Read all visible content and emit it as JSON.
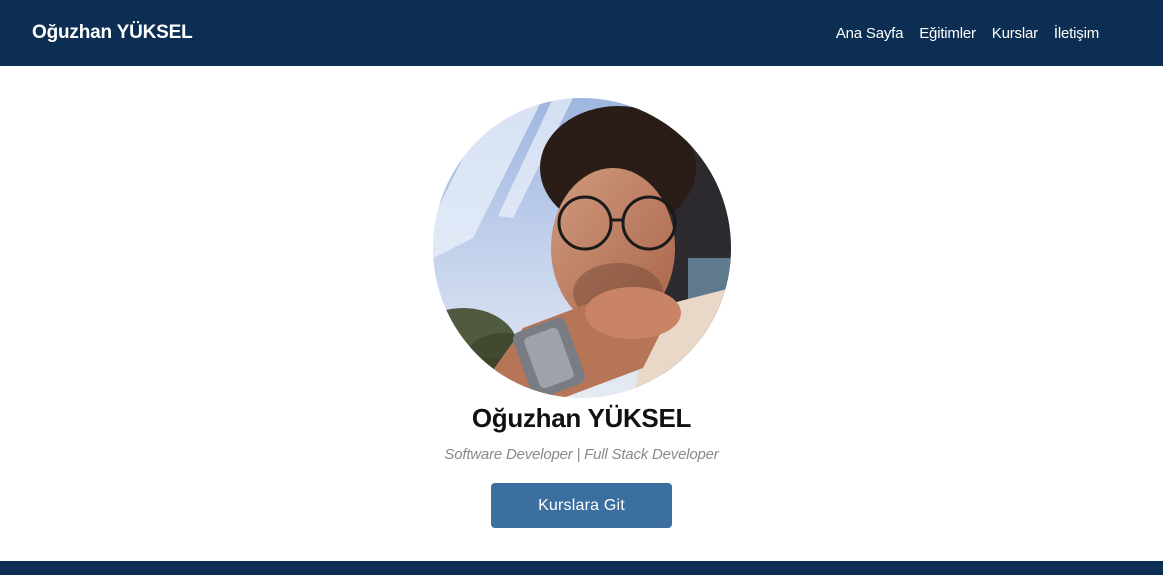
{
  "navbar": {
    "brand": "Oğuzhan YÜKSEL",
    "links": [
      "Ana Sayfa",
      "Eğitimler",
      "Kurslar",
      "İletişim"
    ]
  },
  "profile": {
    "name": "Oğuzhan YÜKSEL",
    "subtitle": "Software Developer | Full Stack Developer",
    "button_label": "Kurslara Git",
    "photo": "profile-photo"
  },
  "colors": {
    "navbar_bg": "#0c2e52",
    "button_bg": "#3a6fa0",
    "subtitle_text": "#8a8a8a"
  }
}
